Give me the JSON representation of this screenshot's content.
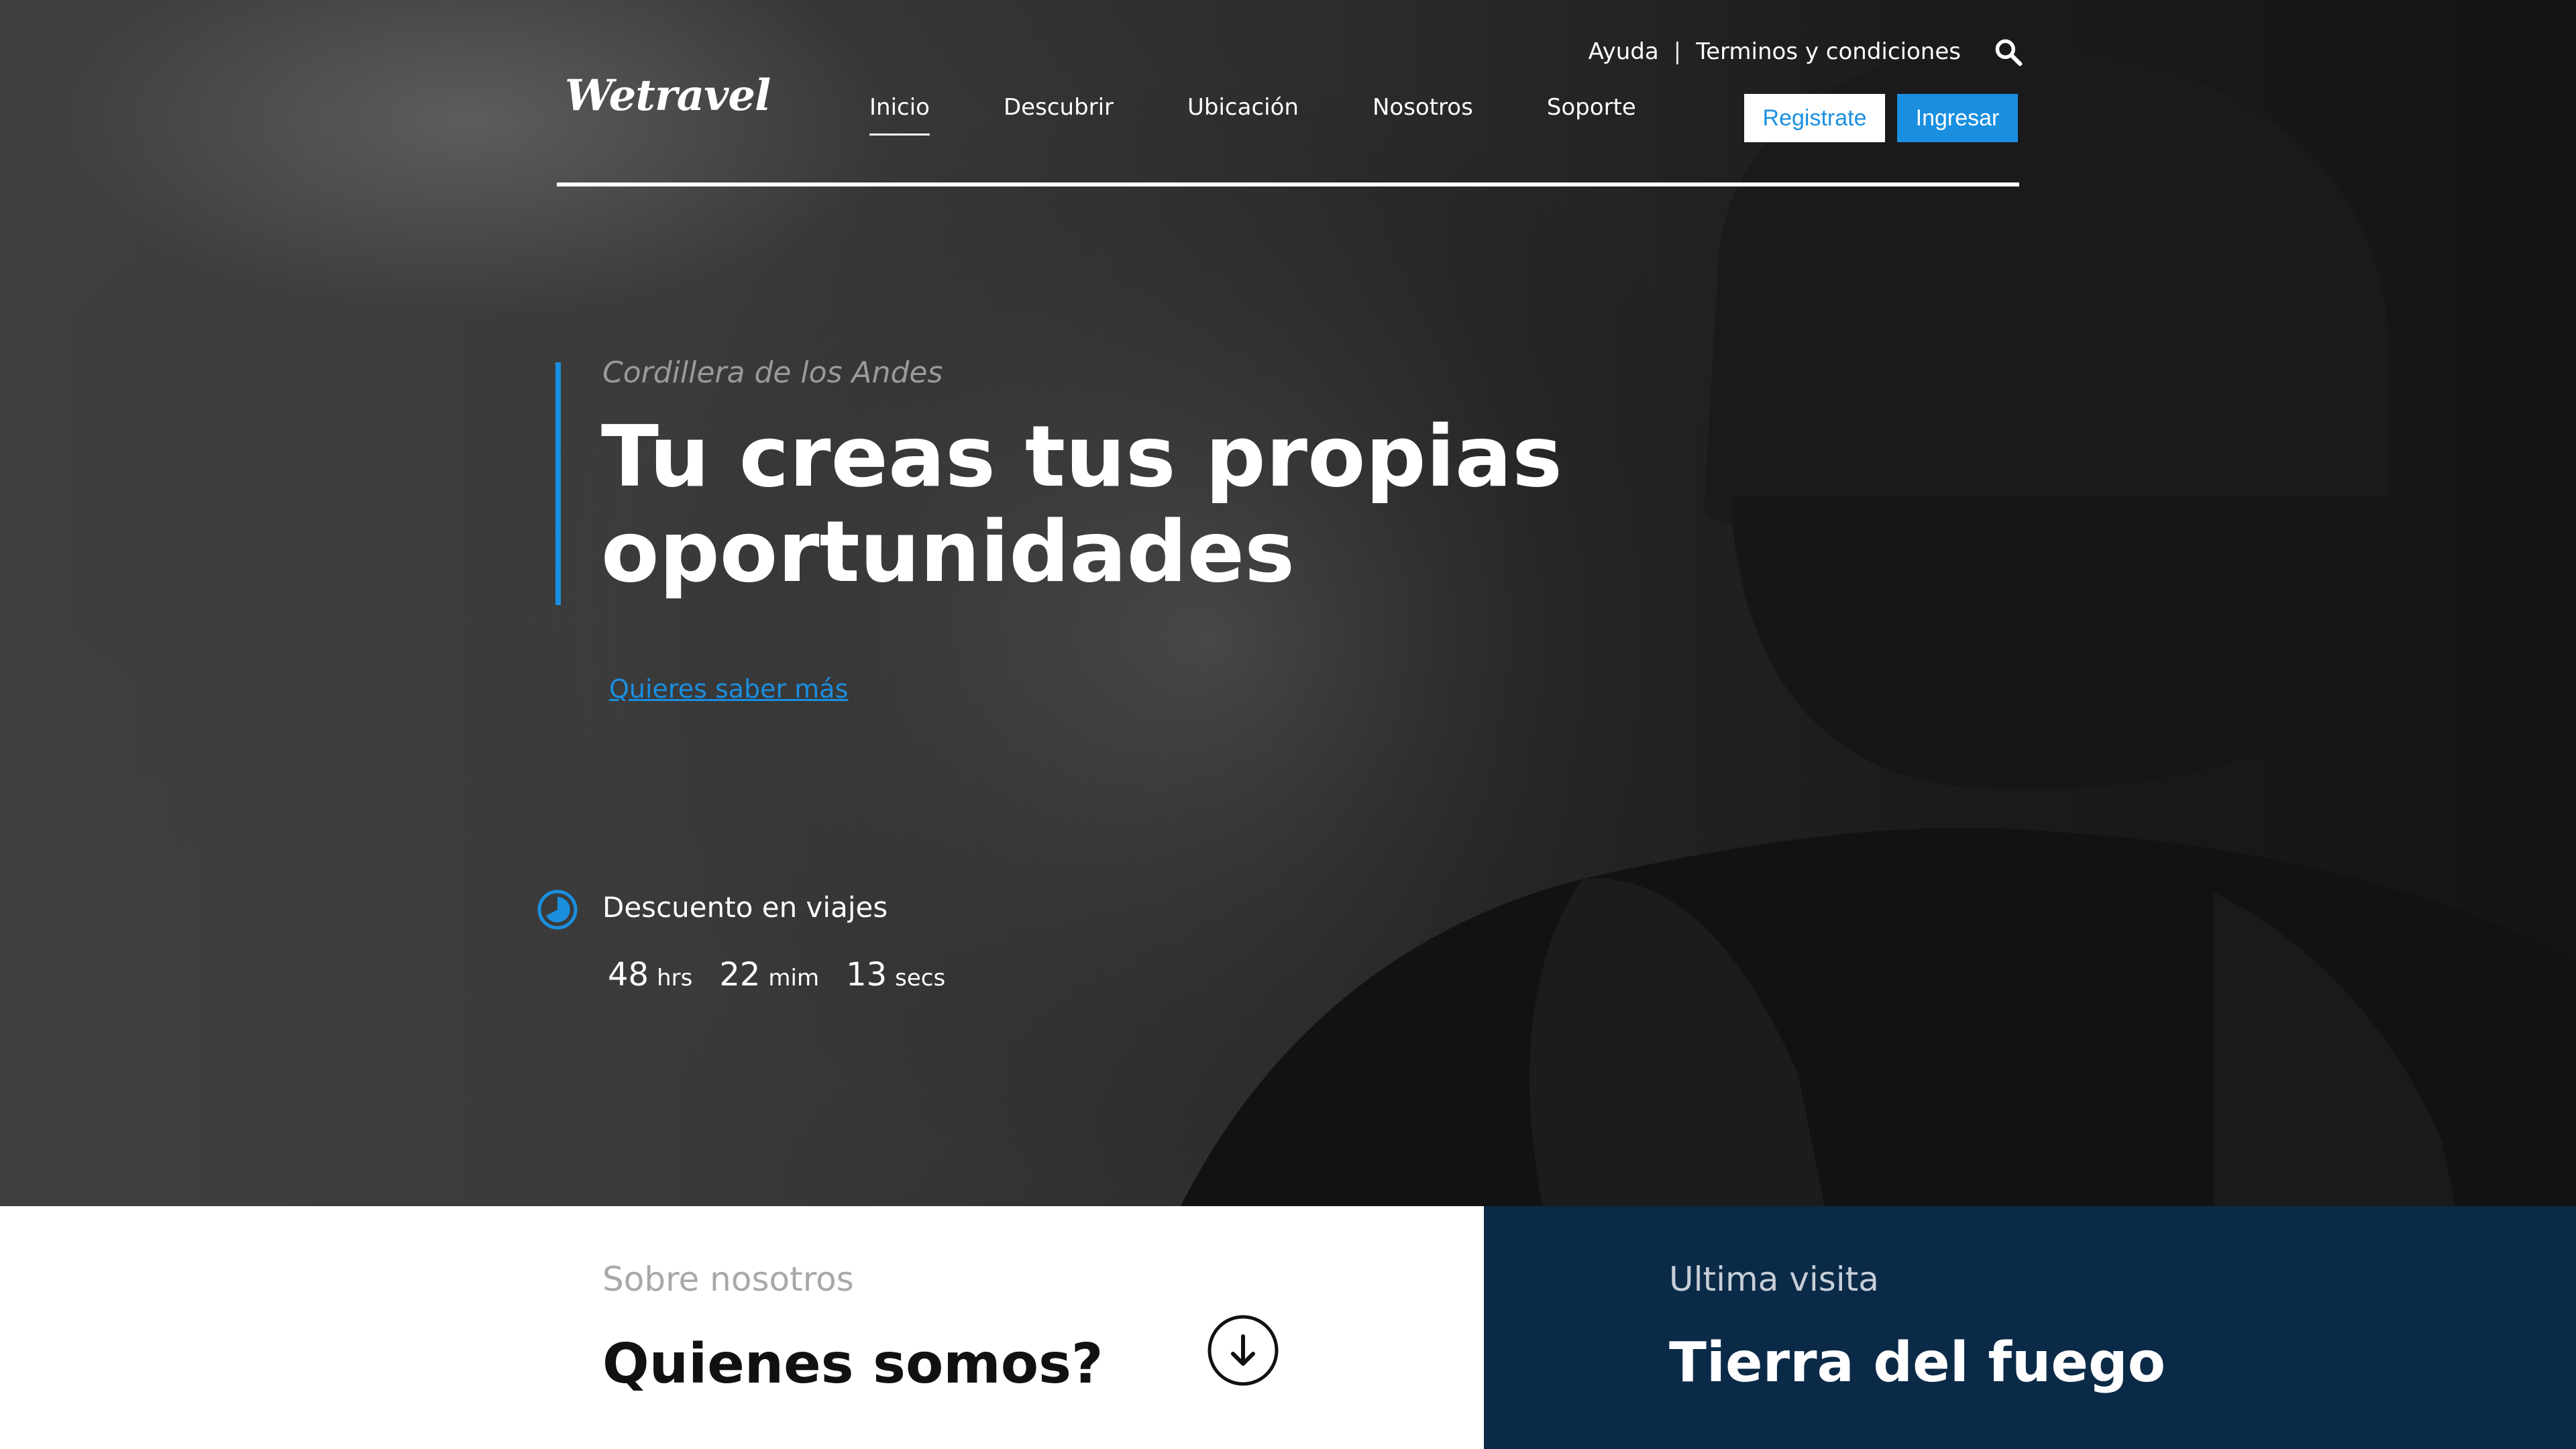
{
  "header": {
    "logo_text": "Wetravel",
    "top_links": [
      "Ayuda",
      "Terminos y condiciones"
    ],
    "separator": "|",
    "nav": [
      {
        "label": "Inicio",
        "active": true
      },
      {
        "label": "Descubrir",
        "active": false
      },
      {
        "label": "Ubicación",
        "active": false
      },
      {
        "label": "Nosotros",
        "active": false
      },
      {
        "label": "Soporte",
        "active": false
      }
    ],
    "register_label": "Registrate",
    "login_label": "Ingresar"
  },
  "hero": {
    "eyebrow": "Cordillera de los Andes",
    "headline_line1": "Tu creas tus propias",
    "headline_line2": "oportunidades",
    "cta_link": "Quieres saber más"
  },
  "discount": {
    "title": "Descuento en viajes",
    "countdown": [
      {
        "value": "48",
        "unit": "hrs"
      },
      {
        "value": "22",
        "unit": "mim"
      },
      {
        "value": "13",
        "unit": "secs"
      }
    ]
  },
  "bottom": {
    "left": {
      "eyebrow": "Sobre nosotros",
      "title": "Quienes somos?"
    },
    "right": {
      "eyebrow": "Ultima visita",
      "title": "Tierra del fuego"
    }
  },
  "icons": {
    "search": "search-icon",
    "clock": "clock-icon",
    "scroll_down": "arrow-down-circle-icon"
  },
  "colors": {
    "accent": "#1a8fe0",
    "dark_panel": "#0b2a48",
    "white": "#ffffff"
  }
}
